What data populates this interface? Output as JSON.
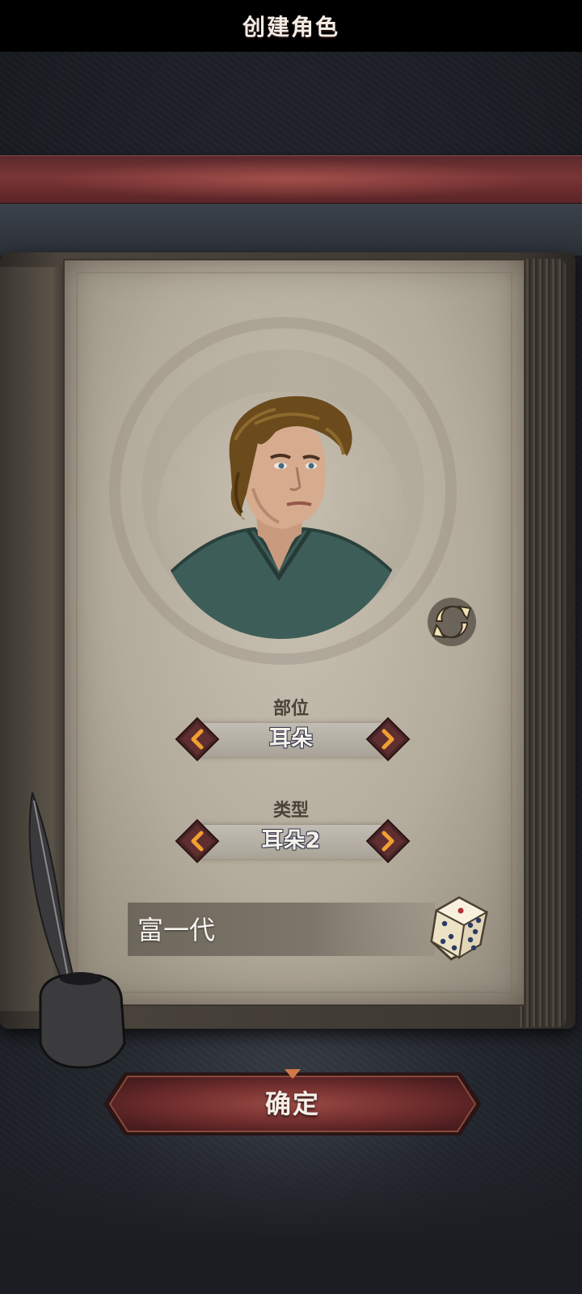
{
  "header": {
    "title": "创建角色"
  },
  "character": {
    "portrait_icon": "character-portrait",
    "refresh_icon": "refresh-icon"
  },
  "part_selector": {
    "label": "部位",
    "value": "耳朵"
  },
  "type_selector": {
    "label": "类型",
    "value": "耳朵2"
  },
  "name_field": {
    "value": "富一代",
    "dice_icon": "dice-icon"
  },
  "confirm_button": {
    "label": "确定"
  },
  "colors": {
    "banner": "#7a3536",
    "page": "#c1b9aa",
    "arrow": "#f0a032",
    "value_outline": "#3a3d52"
  }
}
